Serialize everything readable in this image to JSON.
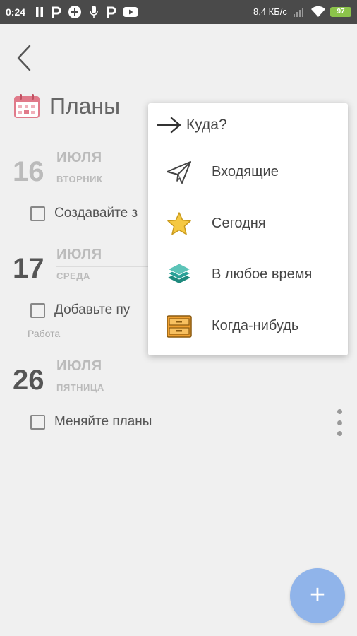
{
  "status_bar": {
    "time": "0:24",
    "network_speed": "8,4 КБ/с",
    "battery": "97"
  },
  "header": {
    "title": "Планы"
  },
  "days": [
    {
      "number": "16",
      "month": "ИЮЛЯ",
      "weekday": "ВТОРНИК",
      "tasks": [
        {
          "text": "Создавайте з",
          "tag": ""
        }
      ]
    },
    {
      "number": "17",
      "month": "ИЮЛЯ",
      "weekday": "СРЕДА",
      "tasks": [
        {
          "text": "Добавьте пу",
          "tag": "Работа"
        }
      ]
    },
    {
      "number": "26",
      "month": "ИЮЛЯ",
      "weekday": "ПЯТНИЦА",
      "tasks": [
        {
          "text": "Меняйте планы",
          "tag": ""
        }
      ]
    }
  ],
  "popup": {
    "title": "Куда?",
    "items": [
      {
        "label": "Входящие",
        "icon": "paper-plane-icon"
      },
      {
        "label": "Сегодня",
        "icon": "star-icon"
      },
      {
        "label": "В любое время",
        "icon": "layers-icon"
      },
      {
        "label": "Когда-нибудь",
        "icon": "drawer-icon"
      }
    ]
  },
  "fab": {
    "label": "+"
  },
  "colors": {
    "status_bar": "#4a4a4a",
    "background": "#f0f0f0",
    "fab": "#90b4ea",
    "star": "#f5c842",
    "layers": "#2aa198",
    "drawer": "#f0a030",
    "battery": "#8bc34a"
  }
}
